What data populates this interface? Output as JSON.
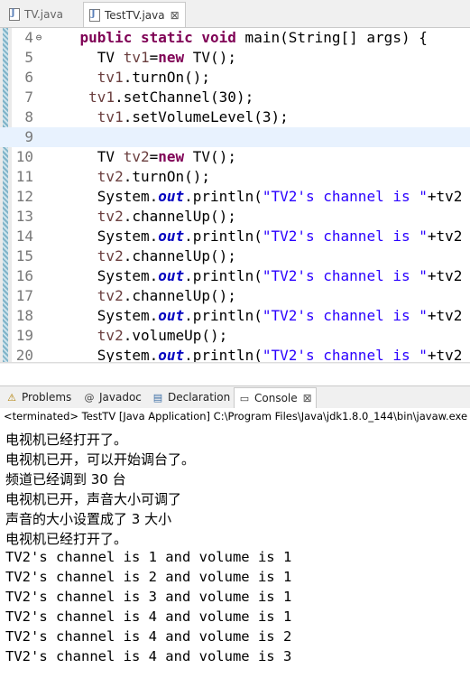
{
  "editor_tabs": [
    {
      "label": "TV.java",
      "active": false
    },
    {
      "label": "TestTV.java",
      "active": true,
      "close": "⊠"
    }
  ],
  "code_lines": [
    {
      "num": "4",
      "fold": "⊖",
      "tokens": [
        [
          "",
          "    "
        ],
        [
          "kw",
          "public static void"
        ],
        [
          "",
          " main(String[] args) {"
        ]
      ]
    },
    {
      "num": "5",
      "tokens": [
        [
          "",
          "      TV "
        ],
        [
          "vr",
          "tv1"
        ],
        [
          "",
          "="
        ],
        [
          "kw",
          "new"
        ],
        [
          "",
          " TV();"
        ]
      ]
    },
    {
      "num": "6",
      "tokens": [
        [
          "",
          "      "
        ],
        [
          "vr",
          "tv1"
        ],
        [
          "",
          ".turnOn();"
        ]
      ]
    },
    {
      "num": "7",
      "tokens": [
        [
          "",
          "     "
        ],
        [
          "vr",
          "tv1"
        ],
        [
          "",
          ".setChannel(30);"
        ]
      ]
    },
    {
      "num": "8",
      "tokens": [
        [
          "",
          "      "
        ],
        [
          "vr",
          "tv1"
        ],
        [
          "",
          ".setVolumeLevel(3);"
        ]
      ]
    },
    {
      "num": "9",
      "current": true,
      "tokens": [
        [
          "",
          ""
        ]
      ]
    },
    {
      "num": "10",
      "tokens": [
        [
          "",
          "      TV "
        ],
        [
          "vr",
          "tv2"
        ],
        [
          "",
          "="
        ],
        [
          "kw",
          "new"
        ],
        [
          "",
          " TV();"
        ]
      ]
    },
    {
      "num": "11",
      "tokens": [
        [
          "",
          "      "
        ],
        [
          "vr",
          "tv2"
        ],
        [
          "",
          ".turnOn();"
        ]
      ]
    },
    {
      "num": "12",
      "tokens": [
        [
          "",
          "      System."
        ],
        [
          "fld",
          "out"
        ],
        [
          "",
          ".println("
        ],
        [
          "str",
          "\"TV2's channel is \""
        ],
        [
          "",
          "+tv2"
        ]
      ]
    },
    {
      "num": "13",
      "tokens": [
        [
          "",
          "      "
        ],
        [
          "vr",
          "tv2"
        ],
        [
          "",
          ".channelUp();"
        ]
      ]
    },
    {
      "num": "14",
      "tokens": [
        [
          "",
          "      System."
        ],
        [
          "fld",
          "out"
        ],
        [
          "",
          ".println("
        ],
        [
          "str",
          "\"TV2's channel is \""
        ],
        [
          "",
          "+tv2"
        ]
      ]
    },
    {
      "num": "15",
      "tokens": [
        [
          "",
          "      "
        ],
        [
          "vr",
          "tv2"
        ],
        [
          "",
          ".channelUp();"
        ]
      ]
    },
    {
      "num": "16",
      "tokens": [
        [
          "",
          "      System."
        ],
        [
          "fld",
          "out"
        ],
        [
          "",
          ".println("
        ],
        [
          "str",
          "\"TV2's channel is \""
        ],
        [
          "",
          "+tv2"
        ]
      ]
    },
    {
      "num": "17",
      "tokens": [
        [
          "",
          "      "
        ],
        [
          "vr",
          "tv2"
        ],
        [
          "",
          ".channelUp();"
        ]
      ]
    },
    {
      "num": "18",
      "tokens": [
        [
          "",
          "      System."
        ],
        [
          "fld",
          "out"
        ],
        [
          "",
          ".println("
        ],
        [
          "str",
          "\"TV2's channel is \""
        ],
        [
          "",
          "+tv2"
        ]
      ]
    },
    {
      "num": "19",
      "tokens": [
        [
          "",
          "      "
        ],
        [
          "vr",
          "tv2"
        ],
        [
          "",
          ".volumeUp();"
        ]
      ]
    },
    {
      "num": "20",
      "tokens": [
        [
          "",
          "      System."
        ],
        [
          "fld",
          "out"
        ],
        [
          "",
          ".println("
        ],
        [
          "str",
          "\"TV2's channel is \""
        ],
        [
          "",
          "+tv2"
        ]
      ]
    }
  ],
  "scroll_arrow": "<",
  "view_tabs": [
    {
      "label": "Problems",
      "icon": "problems-icon",
      "glyph": "⚠"
    },
    {
      "label": "Javadoc",
      "icon": "javadoc-icon",
      "glyph": "@"
    },
    {
      "label": "Declaration",
      "icon": "declaration-icon",
      "glyph": "▤"
    },
    {
      "label": "Console",
      "icon": "console-icon",
      "glyph": "▭",
      "active": true,
      "close": "⊠"
    }
  ],
  "console": {
    "header": "<terminated> TestTV [Java Application] C:\\Program Files\\Java\\jdk1.8.0_144\\bin\\javaw.exe",
    "lines": [
      "电视机已经打开了。",
      "电视机已开，可以开始调台了。",
      "频道已经调到 30 台",
      "电视机已开，声音大小可调了",
      "声音的大小设置成了 3 大小",
      "电视机已经打开了。",
      "TV2's channel is 1 and volume is 1",
      "TV2's channel is 2 and volume is 1",
      "TV2's channel is 3 and volume is 1",
      "TV2's channel is 4 and volume is 1",
      "TV2's channel is 4 and volume is 2",
      "TV2's channel is 4 and volume is 3"
    ]
  },
  "colors": {
    "keyword": "#7f0055",
    "string": "#2a00ff",
    "static_field": "#0000c0",
    "local_var": "#6a3e3e",
    "current_line": "#e8f2fe"
  }
}
